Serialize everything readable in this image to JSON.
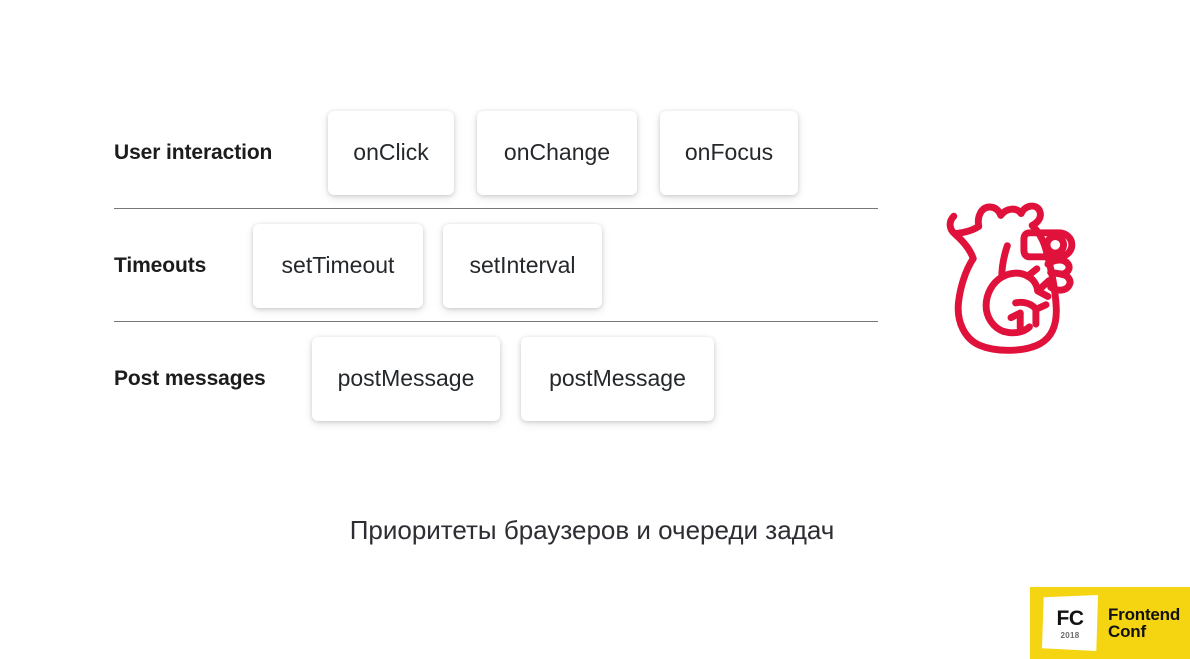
{
  "slide": {
    "caption": "Приоритеты браузеров и очереди задач",
    "background_color": "#ffffff"
  },
  "rows": [
    {
      "label": "User interaction",
      "cards": [
        "onClick",
        "onChange",
        "onFocus"
      ]
    },
    {
      "label": "Timeouts",
      "cards": [
        "setTimeout",
        "setInterval"
      ]
    },
    {
      "label": "Post messages",
      "cards": [
        "postMessage",
        "postMessage"
      ]
    }
  ],
  "illustration": {
    "name": "anatomical-heart-icon",
    "color": "#E0123C"
  },
  "logo": {
    "mark_text": "FC",
    "year": "2018",
    "name_line1": "Frontend",
    "name_line2": "Conf",
    "background_color": "#F5D411",
    "text_color": "#111111"
  },
  "colors": {
    "divider": "#777777",
    "label_text": "#1c1c1c",
    "card_text": "#25282b",
    "caption_text": "#2d2d33"
  }
}
